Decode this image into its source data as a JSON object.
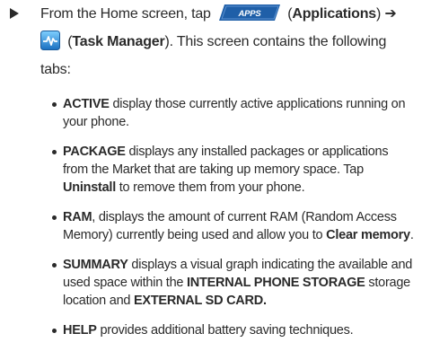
{
  "intro": {
    "from_text": "From the Home screen, tap",
    "apps_label": "APPS",
    "applications_label": "Applications",
    "arrow_symbol": "➔",
    "task_manager_label": "Task Manager",
    "contains_text": ". This screen contains the following",
    "tabs_text": "tabs:"
  },
  "bullets": [
    {
      "term": "ACTIVE",
      "rest": " display those currently active applications running on your phone."
    },
    {
      "term": "PACKAGE",
      "rest": " displays any installed packages or applications from the Market that are taking up memory space. Tap ",
      "term2": "Uninstall",
      "rest2": " to remove them from your phone."
    },
    {
      "term": "RAM",
      "rest": ", displays the amount of current RAM (Random Access Memory) currently being used and allow you to ",
      "term2": "Clear memory",
      "rest2": "."
    },
    {
      "term": "SUMMARY",
      "rest": " displays a visual graph indicating the available and used space within the ",
      "term2": "INTERNAL PHONE STORAGE",
      "rest2": " storage location and ",
      "term3": "EXTERNAL SD CARD."
    },
    {
      "term": "HELP",
      "rest": " provides additional battery saving techniques."
    }
  ],
  "colors": {
    "apps_blue": "#1f5fa8",
    "icon_blue": "#2a7fd0",
    "text": "#2a2a2a"
  },
  "icons": [
    "step-arrow-icon",
    "apps-button-icon",
    "task-manager-icon",
    "bullet-dot"
  ]
}
